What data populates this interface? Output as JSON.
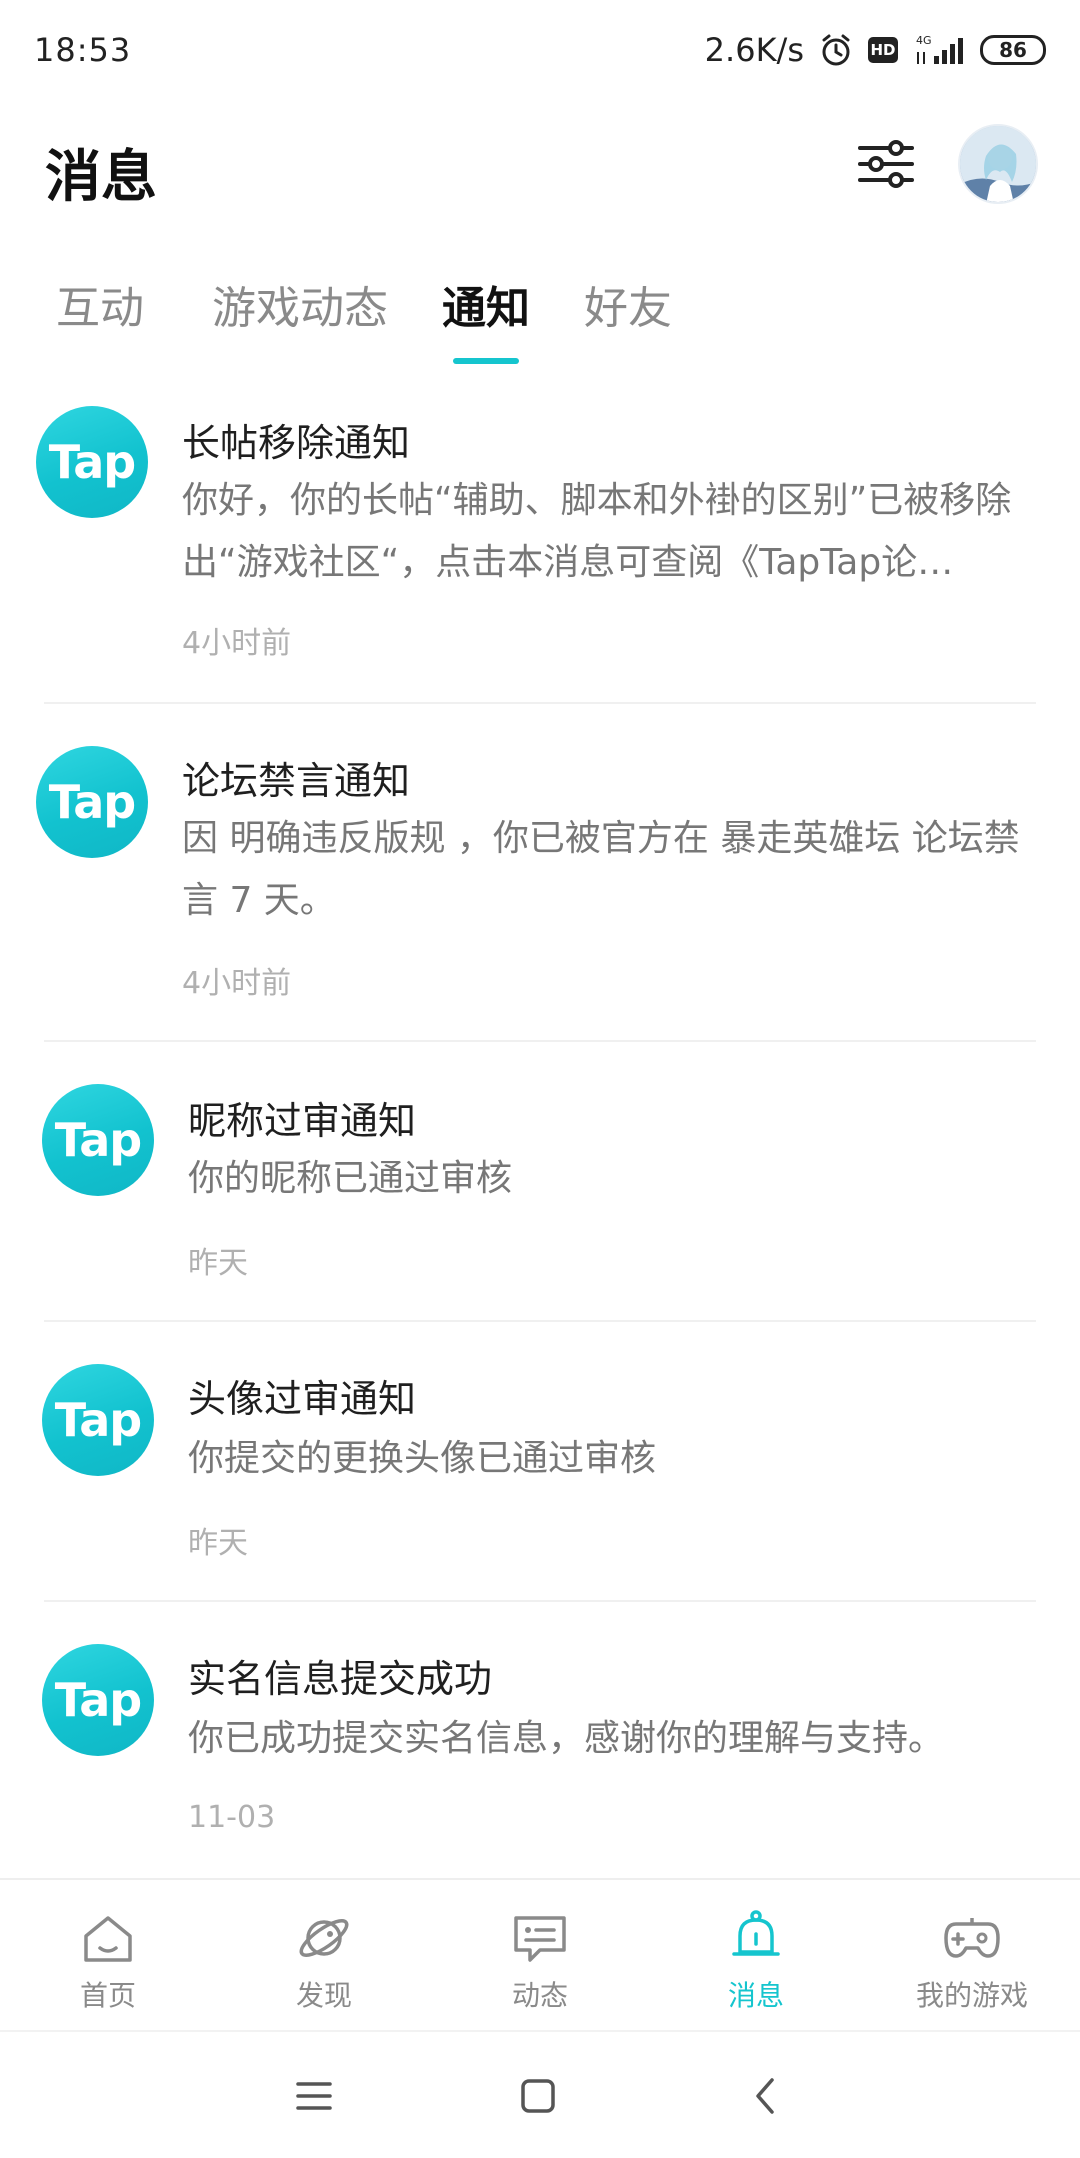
{
  "status_bar": {
    "time": "18:53",
    "speed": "2.6K/s",
    "hd": "HD",
    "network": "4G",
    "battery": "86"
  },
  "header": {
    "title": "消息",
    "filter_icon": "sliders-icon",
    "avatar_icon": "avatar"
  },
  "tabs": [
    {
      "label": "互动"
    },
    {
      "label": "游戏动态"
    },
    {
      "label": "通知",
      "active": true
    },
    {
      "label": "好友"
    }
  ],
  "notifications": [
    {
      "logo": "Tap",
      "title": "长帖移除通知",
      "body": "你好，你的长帖“辅助、脚本和外褂的区别”已被移除出“游戏社区“，点击本消息可查阅《TapTap论…",
      "time": "4小时前"
    },
    {
      "logo": "Tap",
      "title": "论坛禁言通知",
      "body": "因 明确违反版规 ，你已被官方在 暴走英雄坛 论坛禁言 7 天。",
      "time": "4小时前"
    },
    {
      "logo": "Tap",
      "title": "昵称过审通知",
      "body": "你的昵称已通过审核",
      "time": "昨天"
    },
    {
      "logo": "Tap",
      "title": "头像过审通知",
      "body": "你提交的更换头像已通过审核",
      "time": "昨天"
    },
    {
      "logo": "Tap",
      "title": "实名信息提交成功",
      "body": "你已成功提交实名信息，感谢你的理解与支持。",
      "time": "11-03"
    }
  ],
  "bottom_nav": [
    {
      "label": "首页",
      "icon": "home-icon"
    },
    {
      "label": "发现",
      "icon": "planet-icon"
    },
    {
      "label": "动态",
      "icon": "chat-icon"
    },
    {
      "label": "消息",
      "icon": "bell-icon",
      "active": true
    },
    {
      "label": "我的游戏",
      "icon": "gamepad-icon"
    }
  ],
  "colors": {
    "accent": "#15c5ce",
    "inactive": "#8a8a8a"
  }
}
